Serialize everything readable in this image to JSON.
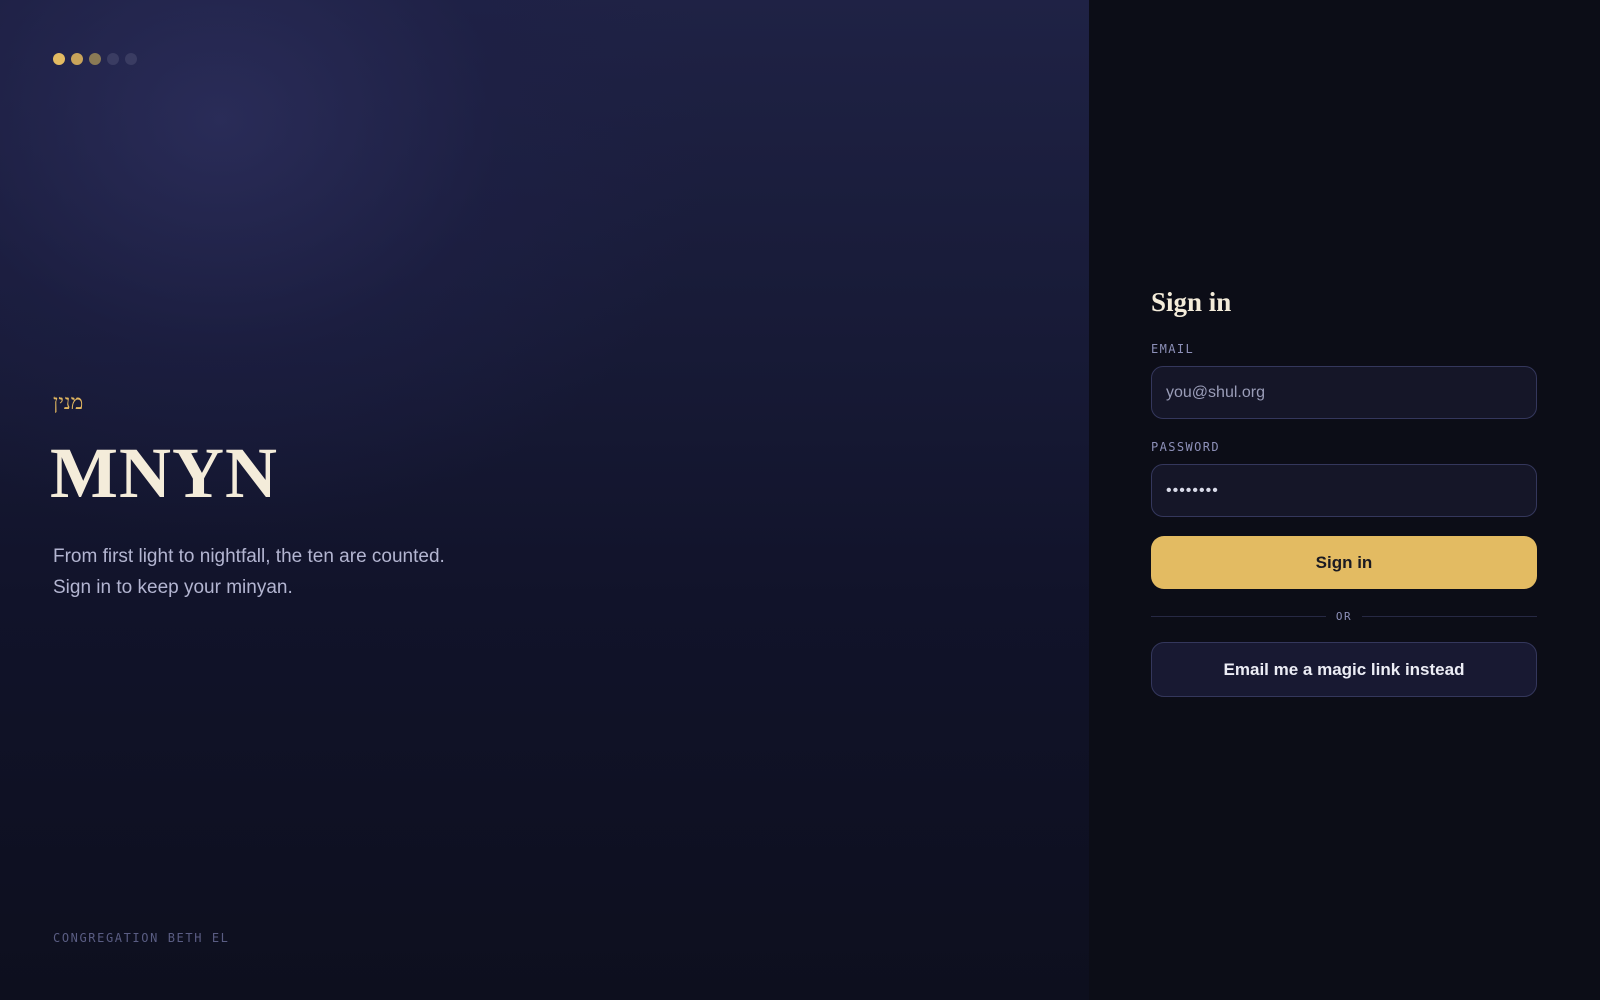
{
  "hero": {
    "progress_dots": [
      {
        "color": "#e3bb62"
      },
      {
        "color": "#c9a45a"
      },
      {
        "color": "#8a7a55"
      },
      {
        "color": "#3a3c62"
      },
      {
        "color": "#3a3c62"
      }
    ],
    "hebrew_name": "מנין",
    "brand": "MNYN",
    "tagline_line1": "From first light to nightfall, the ten are counted.",
    "tagline_line2": "Sign in to keep your minyan.",
    "footer": "CONGREGATION BETH EL"
  },
  "signin": {
    "title": "Sign in",
    "email_label": "EMAIL",
    "email_placeholder": "you@shul.org",
    "password_label": "PASSWORD",
    "password_value": "••••••••",
    "submit_label": "Sign in",
    "divider_text": "OR",
    "magic_link_label": "Email me a magic link instead"
  },
  "colors": {
    "accent": "#e3bb62",
    "background": "#0c0d17",
    "hero_top": "#1f2245",
    "text_light": "#f4ecda"
  }
}
